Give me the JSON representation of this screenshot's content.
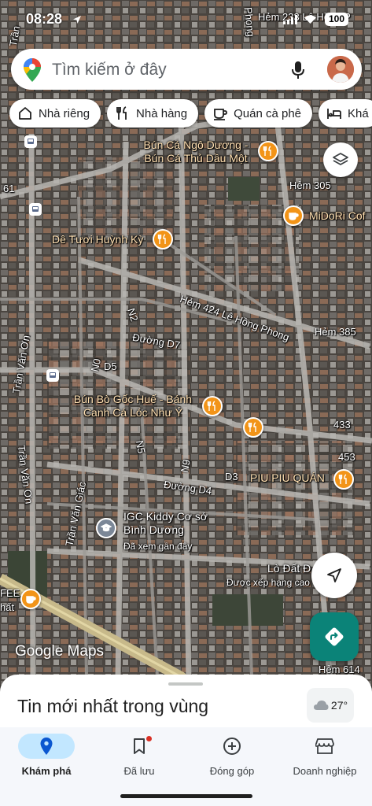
{
  "status_bar": {
    "time": "08:28",
    "battery": "100"
  },
  "search": {
    "placeholder": "Tìm kiếm ở đây"
  },
  "chips": [
    "Nhà riêng",
    "Nhà hàng",
    "Quán cà phê",
    "Khá"
  ],
  "map": {
    "street_labels": [
      "Hẻm 233 Lê Hồng P",
      "Phong",
      "Trần",
      "61",
      "Hẻm 305",
      "Hẻm 424 Lê Hồng Phong",
      "Hẻm 385",
      "N2",
      "Đường D7",
      "N0",
      "D5",
      "Trần Văn Ơn",
      "Trần Văn Ơn",
      "433",
      "453",
      "N5",
      "N9",
      "D3",
      "Đường D4",
      "Trần Văn Giác",
      "FEE",
      "hất",
      "Hẻm 614"
    ],
    "places": [
      {
        "name": "Bún Cá Ngô Dương - Bún Cá Thủ Dầu Một",
        "icon": "restaurant-icon"
      },
      {
        "name": "MiDoRi Cof",
        "icon": "cafe-icon"
      },
      {
        "name": "Dê Tươi Huỳnh Kỳ",
        "icon": "restaurant-icon"
      },
      {
        "name": "Bún Bò Gốc Huế - Bánh Canh Cá Lóc Như Ý",
        "icon": "restaurant-icon"
      },
      {
        "name": "",
        "icon": "restaurant-icon"
      },
      {
        "name": "PIU PIU QUÁN",
        "icon": "restaurant-icon"
      },
      {
        "name": "IGC Kiddy Cơ sở Bình Dương",
        "sub": "Đã xem gần đây",
        "icon": "school-icon"
      },
      {
        "name": "Lò Đất Đ",
        "sub": "Được xếp hạng cao",
        "icon": ""
      },
      {
        "name": "",
        "icon": "cafe-icon"
      }
    ],
    "logo": "Google Maps"
  },
  "sheet": {
    "title": "Tin mới nhất trong vùng",
    "temperature": "27°"
  },
  "nav": {
    "items": [
      "Khám phá",
      "Đã lưu",
      "Đóng góp",
      "Doanh nghiệp"
    ],
    "active": "Khám phá"
  },
  "colors": {
    "accent_blue": "#c2e7ff",
    "directions_teal": "#0b8378",
    "poi_orange": "#f29418"
  }
}
